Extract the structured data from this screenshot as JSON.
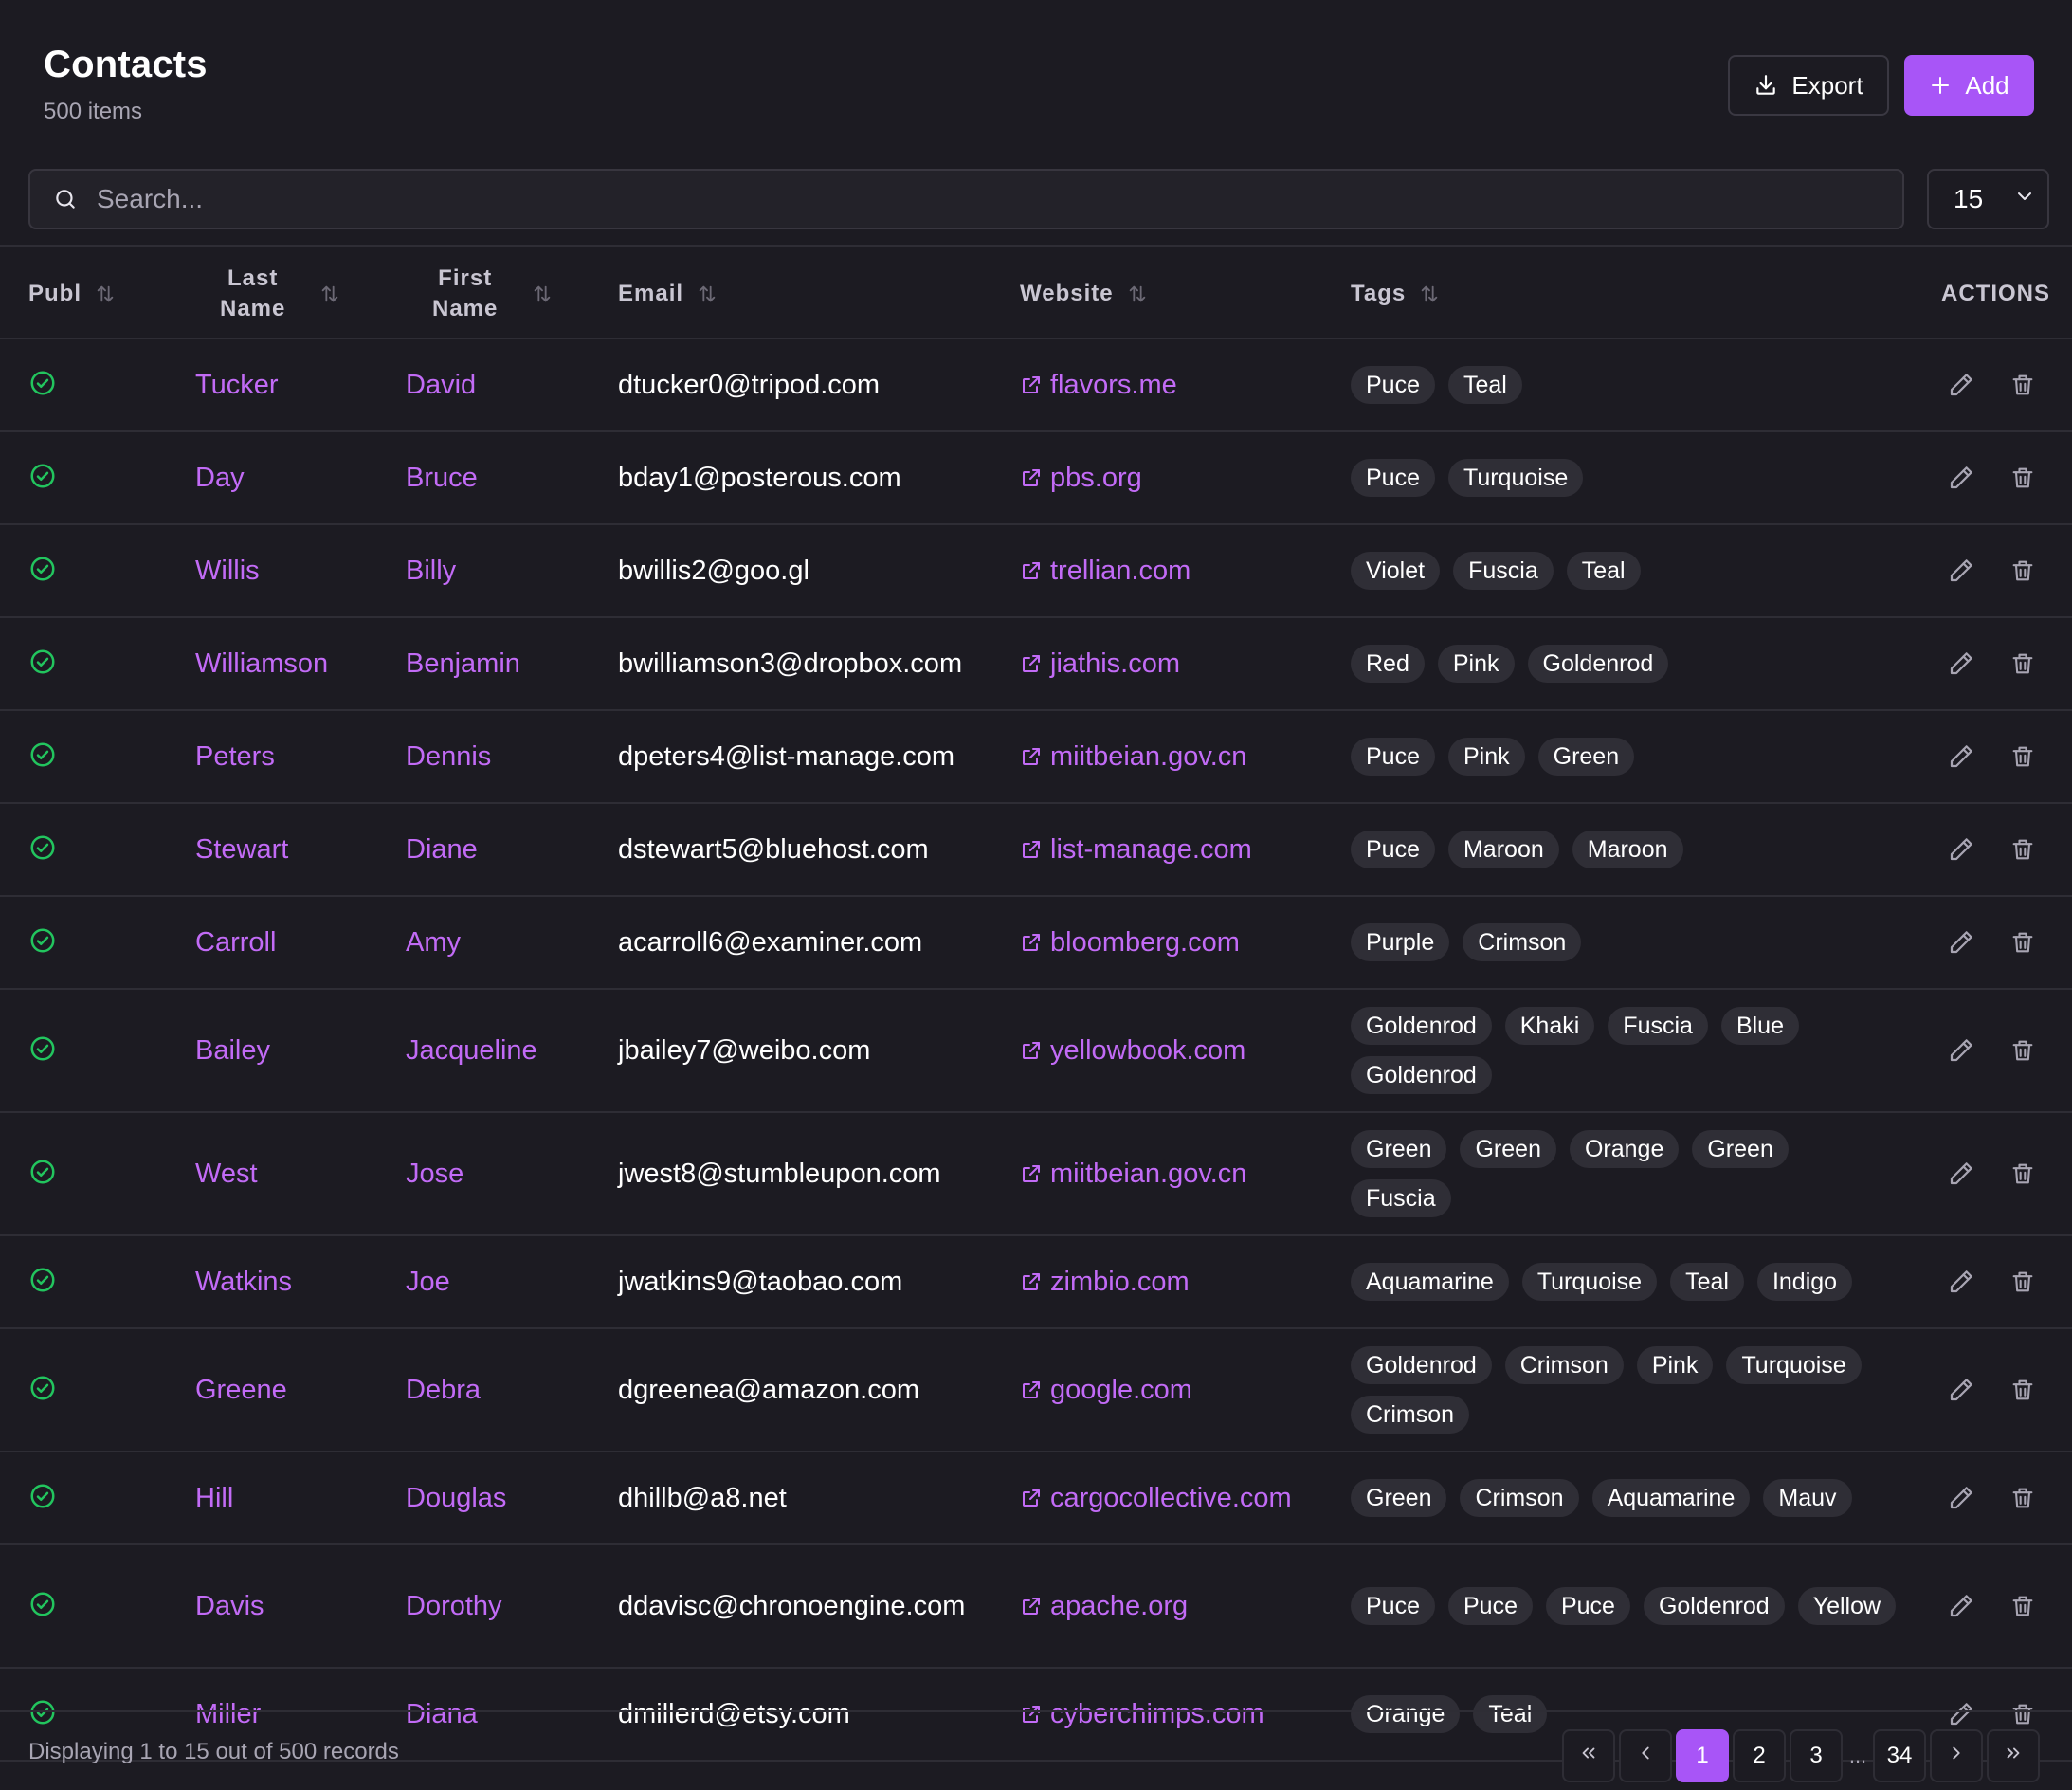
{
  "header": {
    "title": "Contacts",
    "subtitle": "500 items",
    "export_label": "Export",
    "add_label": "Add"
  },
  "search": {
    "placeholder": "Search...",
    "value": ""
  },
  "page_size": {
    "value": "15"
  },
  "columns": {
    "published": "Publ",
    "last_name_line1": "Last",
    "last_name_line2": "Name",
    "first_name_line1": "First",
    "first_name_line2": "Name",
    "email": "Email",
    "website": "Website",
    "tags": "Tags",
    "actions": "ACTIONS"
  },
  "rows": [
    {
      "published": true,
      "last": "Tucker",
      "first": "David",
      "email": "dtucker0@tripod.com",
      "website": "flavors.me",
      "tags": [
        "Puce",
        "Teal"
      ]
    },
    {
      "published": true,
      "last": "Day",
      "first": "Bruce",
      "email": "bday1@posterous.com",
      "website": "pbs.org",
      "tags": [
        "Puce",
        "Turquoise"
      ]
    },
    {
      "published": true,
      "last": "Willis",
      "first": "Billy",
      "email": "bwillis2@goo.gl",
      "website": "trellian.com",
      "tags": [
        "Violet",
        "Fuscia",
        "Teal"
      ]
    },
    {
      "published": true,
      "last": "Williamson",
      "first": "Benjamin",
      "email": "bwilliamson3@dropbox.com",
      "website": "jiathis.com",
      "tags": [
        "Red",
        "Pink",
        "Goldenrod"
      ]
    },
    {
      "published": true,
      "last": "Peters",
      "first": "Dennis",
      "email": "dpeters4@list-manage.com",
      "website": "miitbeian.gov.cn",
      "tags": [
        "Puce",
        "Pink",
        "Green"
      ]
    },
    {
      "published": true,
      "last": "Stewart",
      "first": "Diane",
      "email": "dstewart5@bluehost.com",
      "website": "list-manage.com",
      "tags": [
        "Puce",
        "Maroon",
        "Maroon"
      ]
    },
    {
      "published": true,
      "last": "Carroll",
      "first": "Amy",
      "email": "acarroll6@examiner.com",
      "website": "bloomberg.com",
      "tags": [
        "Purple",
        "Crimson"
      ]
    },
    {
      "published": true,
      "last": "Bailey",
      "first": "Jacqueline",
      "email": "jbailey7@weibo.com",
      "website": "yellowbook.com",
      "tags": [
        "Goldenrod",
        "Khaki",
        "Fuscia",
        "Blue",
        "Goldenrod"
      ]
    },
    {
      "published": true,
      "last": "West",
      "first": "Jose",
      "email": "jwest8@stumbleupon.com",
      "website": "miitbeian.gov.cn",
      "tags": [
        "Green",
        "Green",
        "Orange",
        "Green",
        "Fuscia"
      ]
    },
    {
      "published": true,
      "last": "Watkins",
      "first": "Joe",
      "email": "jwatkins9@taobao.com",
      "website": "zimbio.com",
      "tags": [
        "Aquamarine",
        "Turquoise",
        "Teal",
        "Indigo"
      ]
    },
    {
      "published": true,
      "last": "Greene",
      "first": "Debra",
      "email": "dgreenea@amazon.com",
      "website": "google.com",
      "tags": [
        "Goldenrod",
        "Crimson",
        "Pink",
        "Turquoise",
        "Crimson"
      ]
    },
    {
      "published": true,
      "last": "Hill",
      "first": "Douglas",
      "email": "dhillb@a8.net",
      "website": "cargocollective.com",
      "tags": [
        "Green",
        "Crimson",
        "Aquamarine",
        "Mauv"
      ]
    },
    {
      "published": true,
      "last": "Davis",
      "first": "Dorothy",
      "email": "ddavisc@chronoengine.com",
      "website": "apache.org",
      "tags": [
        "Puce",
        "Puce",
        "Puce",
        "Goldenrod",
        "Yellow"
      ]
    },
    {
      "published": true,
      "last": "Miller",
      "first": "Diana",
      "email": "dmillerd@etsy.com",
      "website": "cyberchimps.com",
      "tags": [
        "Orange",
        "Teal"
      ]
    }
  ],
  "footer": {
    "info": "Displaying 1 to 15 out of 500 records",
    "pages": [
      "1",
      "2",
      "3"
    ],
    "ellipsis": "...",
    "last_page": "34",
    "current_page": "1"
  },
  "colors": {
    "accent": "#a855f7",
    "link": "#c26bf6",
    "published": "#22c55e",
    "background": "#1c1b22"
  },
  "icons": {
    "export": "download-icon",
    "add": "plus-icon",
    "search": "search-icon",
    "select": "chevron-down-icon",
    "sort": "sort-icon",
    "published": "check-circle-icon",
    "website": "external-link-icon",
    "edit": "pencil-icon",
    "delete": "trash-icon",
    "first": "double-chevron-left-icon",
    "prev": "chevron-left-icon",
    "next": "chevron-right-icon",
    "last": "double-chevron-right-icon"
  }
}
